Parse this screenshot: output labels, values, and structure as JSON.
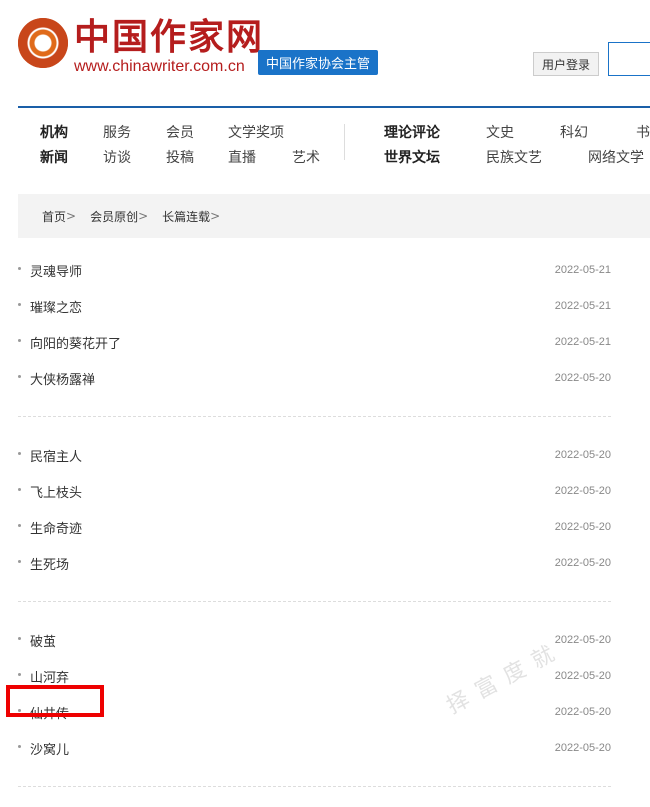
{
  "header": {
    "logo_text": "中国作家网",
    "logo_url": "www.chinawriter.com.cn",
    "sponsor": "中国作家协会主管",
    "login_label": "用户登录"
  },
  "nav": {
    "row1": [
      "机构",
      "服务",
      "会员",
      "文学奖项",
      "理论评论",
      "文史",
      "科幻",
      "书"
    ],
    "row2": [
      "新闻",
      "访谈",
      "投稿",
      "直播",
      "艺术",
      "世界文坛",
      "民族文艺",
      "网络文学"
    ]
  },
  "breadcrumb": [
    "首页",
    "会员原创",
    "长篇连载"
  ],
  "breadcrumb_sep": ">",
  "list_groups": [
    [
      {
        "title": "灵魂导师",
        "date": "2022-05-21"
      },
      {
        "title": "璀璨之恋",
        "date": "2022-05-21"
      },
      {
        "title": "向阳的葵花开了",
        "date": "2022-05-21"
      },
      {
        "title": "大侠杨露禅",
        "date": "2022-05-20"
      }
    ],
    [
      {
        "title": "民宿主人",
        "date": "2022-05-20"
      },
      {
        "title": "飞上枝头",
        "date": "2022-05-20"
      },
      {
        "title": "生命奇迹",
        "date": "2022-05-20"
      },
      {
        "title": "生死场",
        "date": "2022-05-20"
      }
    ],
    [
      {
        "title": "破茧",
        "date": "2022-05-20"
      },
      {
        "title": "山河弃",
        "date": "2022-05-20"
      },
      {
        "title": "仙井传",
        "date": "2022-05-20"
      },
      {
        "title": "沙窝儿",
        "date": "2022-05-20"
      }
    ]
  ],
  "watermark": "择富度就",
  "colors": {
    "brand_red": "#b51d1d",
    "brand_blue": "#1a73c8",
    "highlight": "#e00000"
  }
}
